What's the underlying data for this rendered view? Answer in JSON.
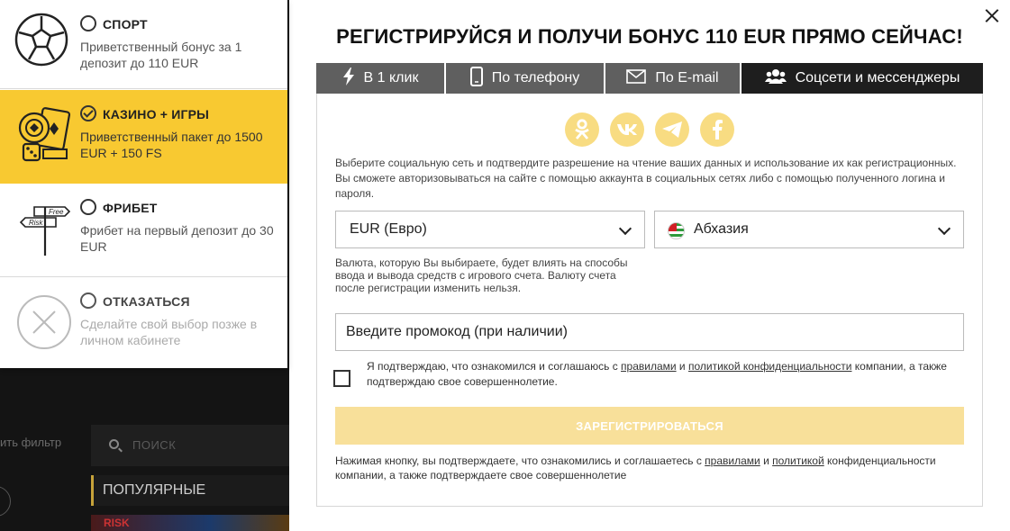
{
  "background": {
    "filter_text": "ить фильтр",
    "search_placeholder": "ПОИСК",
    "popular_label": "ПОПУЛЯРНЫЕ",
    "thumb_text": "RISK"
  },
  "bonus_options": [
    {
      "title": "СПОРТ",
      "desc": "Приветственный бонус за 1 депозит до 110 EUR",
      "selected": false
    },
    {
      "title": "КАЗИНО + ИГРЫ",
      "desc": "Приветственный пакет до 1500 EUR + 150 FS",
      "selected": true
    },
    {
      "title": "ФРИБЕТ",
      "desc": "Фрибет на первый депозит до 30 EUR",
      "selected": false,
      "sign_top": "Free",
      "sign_bottom": "Risk"
    },
    {
      "title": "ОТКАЗАТЬСЯ",
      "desc": "Сделайте свой выбор позже в личном кабинете",
      "selected": false
    }
  ],
  "modal": {
    "title": "РЕГИСТРИРУЙСЯ И ПОЛУЧИ БОНУС 110 EUR ПРЯМО СЕЙЧАС!",
    "tabs": [
      {
        "label": "В 1 клик",
        "icon": "lightning-icon"
      },
      {
        "label": "По телефону",
        "icon": "phone-icon"
      },
      {
        "label": "По E-mail",
        "icon": "envelope-icon"
      },
      {
        "label": "Соцсети и мессенджеры",
        "icon": "users-icon",
        "active": true
      }
    ],
    "socials": [
      "odnoklassniki-icon",
      "vk-icon",
      "telegram-icon",
      "facebook-icon"
    ],
    "info": "Выберите социальную сеть и подтвердите разрешение на чтение ваших данных и использование их как регистрационных. Вы сможете авторизовываться на сайте с помощью аккаунта в социальных сетях либо с помощью полученного логина и пароля.",
    "currency_value": "EUR (Евро)",
    "country_value": "Абхазия",
    "currency_hint": "Валюта, которую Вы выбираете, будет влиять на способы ввода и вывода средств с игрового счета. Валюту счета после регистрации изменить нельзя.",
    "promo_placeholder": "Введите промокод (при наличии)",
    "agree_pre": "Я подтверждаю, что ознакомился и соглашаюсь с ",
    "agree_rules": "правилами",
    "agree_and": " и ",
    "agree_policy": "политикой конфиденциальности",
    "agree_post": " компании, а также подтверждаю свое совершеннолетие.",
    "register_label": "ЗАРЕГИСТРИРОВАТЬСЯ",
    "note_pre": "Нажимая кнопку, вы подтверждаете, что ознакомились и соглашаетесь с ",
    "note_rules": "правилами",
    "note_and": " и ",
    "note_policy": "политикой",
    "note_post": " конфиденциальности компании, а также подтверждаете свое совершеннолетие"
  },
  "colors": {
    "accent_yellow": "#f8c931",
    "button_disabled": "#f8e09a",
    "tab_bg": "#5f5f5f",
    "tab_active": "#1e1e1e",
    "social_bg": "#f8dc82"
  }
}
